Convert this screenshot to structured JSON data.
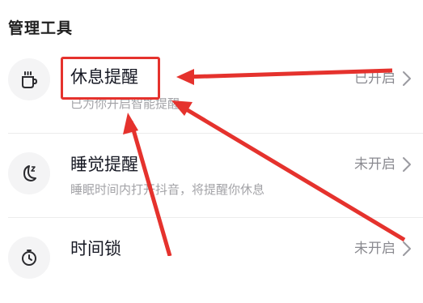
{
  "section": {
    "title": "管理工具"
  },
  "rows": [
    {
      "icon": "cup-icon",
      "title": "休息提醒",
      "subtitle": "已为你开启智能提醒",
      "status": "已开启"
    },
    {
      "icon": "moon-sleep-icon",
      "title": "睡觉提醒",
      "subtitle": "睡眠时间内打开抖音，将提醒你休息",
      "status": "未开启"
    },
    {
      "icon": "clock-lock-icon",
      "title": "时间锁",
      "subtitle": "",
      "status": "未开启"
    }
  ],
  "annotation": {
    "highlight_color": "#e5322d"
  }
}
